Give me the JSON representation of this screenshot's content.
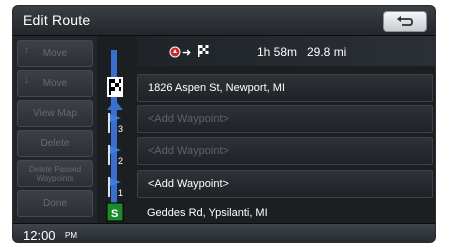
{
  "window": {
    "title": "Edit Route"
  },
  "left_buttons": [
    {
      "label": "Move",
      "arrow": "↑"
    },
    {
      "label": "Move",
      "arrow": "↓"
    },
    {
      "label": "View Map"
    },
    {
      "label": "Delete"
    },
    {
      "label": "Delete Passed Waypoints"
    },
    {
      "label": "Done"
    }
  ],
  "summary": {
    "time": "1h 58m",
    "distance": "29.8 mi"
  },
  "rows": [
    {
      "text": "1826 Aspen St, Newport, MI",
      "icon": "destination-flag-icon",
      "state": "active"
    },
    {
      "text": "<Add Waypoint>",
      "icon": "waypoint-3-icon",
      "badge": "3",
      "state": "dim"
    },
    {
      "text": "<Add Waypoint>",
      "icon": "waypoint-2-icon",
      "badge": "2",
      "state": "dim"
    },
    {
      "text": "<Add Waypoint>",
      "icon": "waypoint-1-icon",
      "badge": "1",
      "state": "active"
    },
    {
      "text": "Geddes Rd, Ypsilanti, MI",
      "icon": "start-s-icon",
      "badge": "S",
      "state": "plain"
    }
  ],
  "status": {
    "time": "12:00",
    "ampm": "PM"
  },
  "colors": {
    "accent_blue": "#3a6fd0",
    "start_green": "#1f8a2a",
    "button_text_disabled": "#666b70"
  }
}
